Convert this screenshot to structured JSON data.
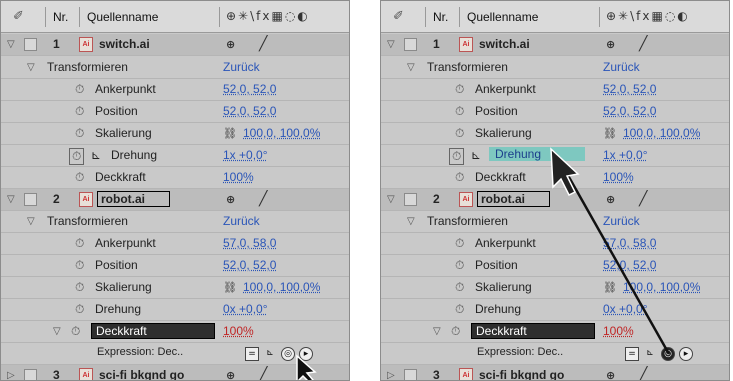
{
  "header": {
    "pencil_icon": "pencil-icon",
    "nr": "Nr.",
    "source_name": "Quellenname",
    "switches": "⊕✳\\fx▦◌◐"
  },
  "layers": [
    {
      "num": "1",
      "name": "switch.ai"
    },
    {
      "num": "2",
      "name": "robot.ai"
    },
    {
      "num": "3",
      "name": "sci-fi bkgnd go"
    }
  ],
  "transform": {
    "label": "Transformieren",
    "reset": "Zurück"
  },
  "props": {
    "anchor": "Ankerpunkt",
    "position": "Position",
    "scale": "Skalierung",
    "rotation": "Drehung",
    "opacity": "Deckkraft"
  },
  "layer1_values": {
    "anchor": "52,0, 52,0",
    "position": "52,0, 52,0",
    "scale": "100,0, 100,0%",
    "rotation": "1x +0,0°",
    "opacity": "100%"
  },
  "layer2_values": {
    "anchor": "57,0, 58,0",
    "position": "52,0, 52,0",
    "scale": "100,0, 100,0%",
    "rotation": "0x +0,0°",
    "opacity": "100%"
  },
  "expression_label": "Expression: Dec.."
}
